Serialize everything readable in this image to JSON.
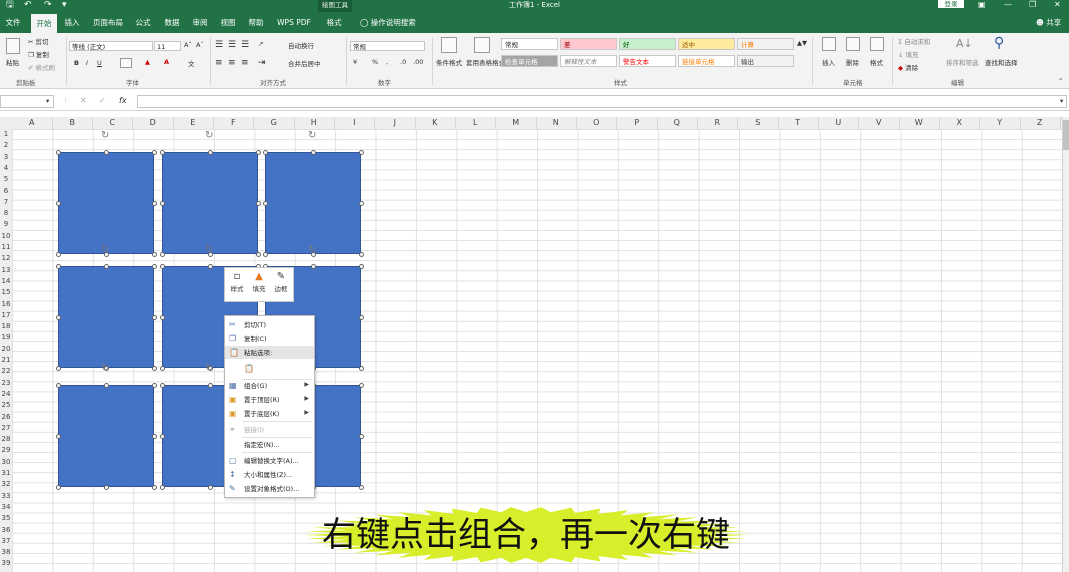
{
  "colors": {
    "excel_green": "#217346",
    "shape_fill": "#4472c4",
    "caption_bg": "#d8ee2a"
  },
  "titlebar": {
    "title": "工作簿1 - Excel",
    "context_tab": "绘图工具",
    "login": "登录",
    "icons": [
      "save-icon",
      "undo-icon",
      "redo-icon",
      "customize-icon",
      "ribbon-display-icon",
      "minimize-icon",
      "restore-icon",
      "close-icon"
    ]
  },
  "tabs": [
    "文件",
    "开始",
    "插入",
    "页面布局",
    "公式",
    "数据",
    "审阅",
    "视图",
    "帮助",
    "WPS PDF",
    "格式"
  ],
  "search_tab": "操作说明搜索",
  "share": "共享",
  "ribbon": {
    "clipboard": {
      "paste": "粘贴",
      "cut": "剪切",
      "copy": "复制",
      "format_painter": "格式刷",
      "group": "剪贴板"
    },
    "font": {
      "name": "等线 (正文)",
      "size": "11",
      "bold": "B",
      "italic": "I",
      "underline": "U",
      "group": "字体"
    },
    "alignment": {
      "wrap": "自动换行",
      "merge": "合并后居中",
      "group": "对齐方式"
    },
    "number": {
      "format": "常规",
      "group": "数字"
    },
    "styles": {
      "conditional": "条件格式",
      "table_format": "套用表格格式",
      "cells": [
        "常规",
        "差",
        "好",
        "适中",
        "计算",
        "检查单元格",
        "解释性文本",
        "警告文本",
        "链接单元格",
        "输出"
      ],
      "group": "样式"
    },
    "cells": {
      "insert": "插入",
      "delete": "删除",
      "format": "格式",
      "group": "单元格"
    },
    "editing": {
      "autosum": "自动求和",
      "fill": "填充",
      "clear": "清除",
      "sort": "排序和筛选",
      "find": "查找和选择",
      "group": "编辑"
    }
  },
  "formula_bar": {
    "fx": "fx",
    "name_box": "",
    "content": ""
  },
  "columns": [
    "A",
    "B",
    "C",
    "D",
    "E",
    "F",
    "G",
    "H",
    "I",
    "J",
    "K",
    "L",
    "M",
    "N",
    "O",
    "P",
    "Q",
    "R",
    "S",
    "T",
    "U",
    "V",
    "W",
    "X",
    "Y",
    "Z"
  ],
  "rows": [
    "1",
    "2",
    "3",
    "4",
    "5",
    "6",
    "7",
    "8",
    "9",
    "10",
    "11",
    "12",
    "13",
    "14",
    "15",
    "16",
    "17",
    "18",
    "19",
    "20",
    "21",
    "22",
    "23",
    "24",
    "25",
    "26",
    "27",
    "28",
    "29",
    "30",
    "31",
    "32",
    "33",
    "34",
    "35",
    "36",
    "37",
    "38",
    "39"
  ],
  "mini_toolbar": [
    {
      "icon": "shape-style-icon",
      "label": "样式"
    },
    {
      "icon": "fill-bucket-icon",
      "label": "填充"
    },
    {
      "icon": "outline-pen-icon",
      "label": "边框"
    }
  ],
  "context_menu": [
    {
      "label": "剪切(T)",
      "icon": "scissors-icon",
      "disabled": false
    },
    {
      "label": "复制(C)",
      "icon": "copy-icon",
      "disabled": false
    },
    {
      "label": "粘贴选项:",
      "icon": "paste-options-icon",
      "disabled": false
    },
    {
      "label": "",
      "icon": "clipboard-icon",
      "disabled": false
    },
    {
      "label": "组合(G)",
      "icon": "group-icon",
      "disabled": false,
      "submenu": true
    },
    {
      "label": "置于顶层(R)",
      "icon": "bring-front-icon",
      "disabled": false,
      "submenu": true
    },
    {
      "label": "置于底层(K)",
      "icon": "send-back-icon",
      "disabled": false,
      "submenu": true
    },
    {
      "label": "链接(I)",
      "icon": "link-icon",
      "disabled": true
    },
    {
      "label": "指定宏(N)...",
      "icon": "",
      "disabled": false
    },
    {
      "label": "编辑替换文字(A)...",
      "icon": "alt-text-icon",
      "disabled": false
    },
    {
      "label": "大小和属性(Z)...",
      "icon": "size-icon",
      "disabled": false
    },
    {
      "label": "设置对象格式(O)...",
      "icon": "format-object-icon",
      "disabled": false
    }
  ],
  "caption": "右键点击组合，再一次右键"
}
